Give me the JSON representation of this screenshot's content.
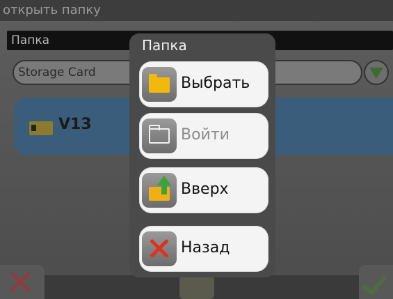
{
  "app": {
    "title": "открыть папку",
    "folder_header": "Папка",
    "path_value": "Storage Card",
    "folder_item": "V13"
  },
  "icons": {
    "dropdown": "chevron-down-icon",
    "row": "sd-card-icon",
    "cancel": "close-icon",
    "confirm": "checkmark-icon"
  },
  "popup": {
    "title": "Папка",
    "items": [
      {
        "label": "Выбрать",
        "icon": "folder-icon",
        "enabled": true
      },
      {
        "label": "Войти",
        "icon": "folder-open-icon",
        "enabled": false
      },
      {
        "label": "Вверх",
        "icon": "folder-up-icon",
        "enabled": true
      },
      {
        "label": "Назад",
        "icon": "close-icon",
        "enabled": true
      }
    ]
  },
  "colors": {
    "accent_row": "#3b5d7c",
    "confirm": "#4c6d3e",
    "cancel": "#e0301f"
  }
}
